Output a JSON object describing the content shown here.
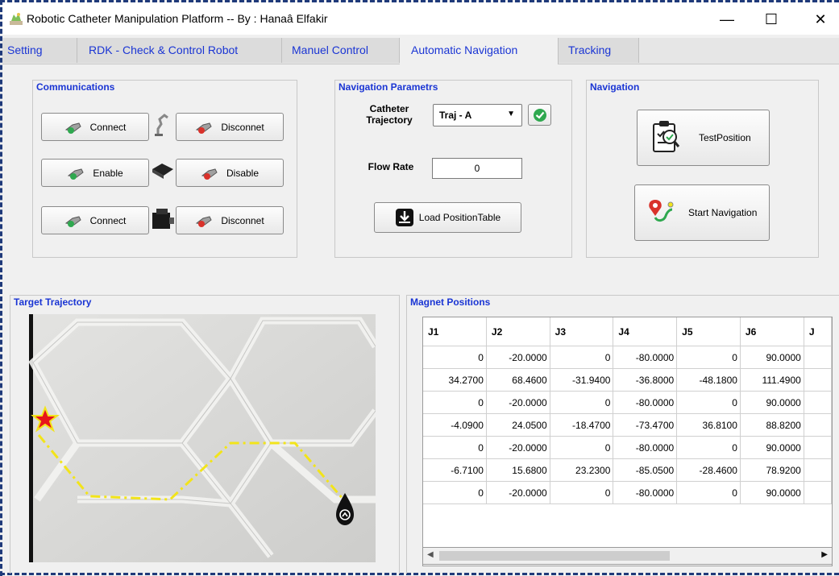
{
  "window": {
    "title": "Robotic Catheter Manipulation Platform -- By : Hanaâ Elfakir",
    "minimize": "—",
    "maximize": "☐",
    "close": "✕"
  },
  "tabs": [
    {
      "label": "Setting"
    },
    {
      "label": "RDK - Check & Control Robot"
    },
    {
      "label": "Manuel Control"
    },
    {
      "label": "Automatic Navigation",
      "active": true
    },
    {
      "label": "Tracking"
    }
  ],
  "communications": {
    "title": "Communications",
    "row1": {
      "left": "Connect",
      "right": "Disconnet"
    },
    "row2": {
      "left": "Enable",
      "right": "Disable"
    },
    "row3": {
      "left": "Connect",
      "right": "Disconnet"
    }
  },
  "nav_params": {
    "title": "Navigation Parametrs",
    "trajectory_label_1": "Catheter",
    "trajectory_label_2": "Trajectory",
    "trajectory_value": "Traj - A",
    "flow_label": "Flow Rate",
    "flow_value": "0",
    "load_button": "Load PositionTable"
  },
  "navigation": {
    "title": "Navigation",
    "test_button": "TestPosition",
    "start_button": "Start Navigation"
  },
  "target_trajectory": {
    "title": "Target Trajectory"
  },
  "magnet_positions": {
    "title": "Magnet Positions",
    "columns": [
      "J1",
      "J2",
      "J3",
      "J4",
      "J5",
      "J6",
      "J"
    ],
    "rows": [
      [
        "0",
        "-20.0000",
        "0",
        "-80.0000",
        "0",
        "90.0000"
      ],
      [
        "34.2700",
        "68.4600",
        "-31.9400",
        "-36.8000",
        "-48.1800",
        "111.4900"
      ],
      [
        "0",
        "-20.0000",
        "0",
        "-80.0000",
        "0",
        "90.0000"
      ],
      [
        "-4.0900",
        "24.0500",
        "-18.4700",
        "-73.4700",
        "36.8100",
        "88.8200"
      ],
      [
        "0",
        "-20.0000",
        "0",
        "-80.0000",
        "0",
        "90.0000"
      ],
      [
        "-6.7100",
        "15.6800",
        "23.2300",
        "-85.0500",
        "-28.4600",
        "78.9200"
      ],
      [
        "0",
        "-20.0000",
        "0",
        "-80.0000",
        "0",
        "90.0000"
      ]
    ]
  },
  "colors": {
    "tab_text": "#1a35d4",
    "panel_title": "#1a35d4",
    "trajectory_line": "#f2e41a",
    "start_marker": "#e8141b"
  }
}
